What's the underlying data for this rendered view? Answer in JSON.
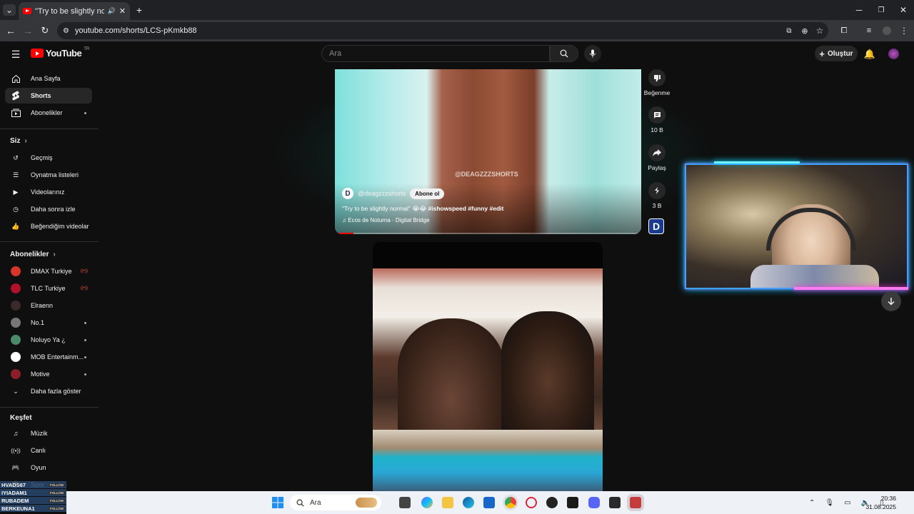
{
  "browser": {
    "tab_title": "\"Try to be slightly normal\" 😭😂",
    "url": "youtube.com/shorts/LCS-pKmkb88"
  },
  "masthead": {
    "logo_text": "YouTube",
    "country": "TR",
    "search_placeholder": "Ara",
    "create_label": "Oluştur"
  },
  "sidebar": {
    "main": [
      {
        "label": "Ana Sayfa",
        "icon": "home-icon"
      },
      {
        "label": "Shorts",
        "icon": "shorts-icon",
        "active": true
      },
      {
        "label": "Abonelikler",
        "icon": "subscriptions-icon"
      }
    ],
    "you_title": "Siz",
    "you": [
      {
        "label": "Geçmiş",
        "icon": "history-icon"
      },
      {
        "label": "Oynatma listeleri",
        "icon": "playlists-icon"
      },
      {
        "label": "Videolarınız",
        "icon": "your-videos-icon"
      },
      {
        "label": "Daha sonra izle",
        "icon": "watch-later-icon"
      },
      {
        "label": "Beğendiğim videolar",
        "icon": "liked-icon"
      }
    ],
    "subs_title": "Abonelikler",
    "subs": [
      {
        "label": "DMAX Turkiye",
        "color": "#d9352a"
      },
      {
        "label": "TLC Turkiye",
        "color": "#b0102a"
      },
      {
        "label": "Elraenn",
        "color": "#3a2a2a"
      },
      {
        "label": "No.1",
        "color": "#777777"
      },
      {
        "label": "Noluyo Ya ¿",
        "color": "#4a8a6a"
      },
      {
        "label": "MOB Entertainm...",
        "color": "#ffffff"
      },
      {
        "label": "Motive",
        "color": "#8a1f2a"
      }
    ],
    "show_more": "Daha fazla göster",
    "explore_title": "Keşfet",
    "explore": [
      {
        "label": "Müzik",
        "icon": "music-icon"
      },
      {
        "label": "Canlı",
        "icon": "live-icon"
      },
      {
        "label": "Oyun",
        "icon": "gaming-icon"
      },
      {
        "label": "Spor",
        "icon": "sports-icon"
      }
    ]
  },
  "short": {
    "watermark": "@DEAGZZZSHORTS",
    "channel": "@deagzzzshorts",
    "subscribe": "Abone ol",
    "title_prefix": "\"Try to be slightly normal\" 😭😂",
    "hashtags": "#ishowspeed #funny #edit",
    "music": "Ecos de Noturna · Digital Bridge",
    "progress": 0.06
  },
  "actions": {
    "dislike": "Beğenme",
    "comments": "10 B",
    "share": "Paylaş",
    "remix": "3 B"
  },
  "stream_overlay": [
    {
      "name": "HVADS67",
      "follow": "FOLLOW"
    },
    {
      "name": "IYIADAM1",
      "follow": "FOLLOW"
    },
    {
      "name": "RUBADEM",
      "follow": "FOLLOW"
    },
    {
      "name": "BERKEUNA1",
      "follow": "FOLLOW"
    }
  ],
  "taskbar": {
    "search": "Ara",
    "time": "20:36",
    "date": "31.08.2025"
  }
}
